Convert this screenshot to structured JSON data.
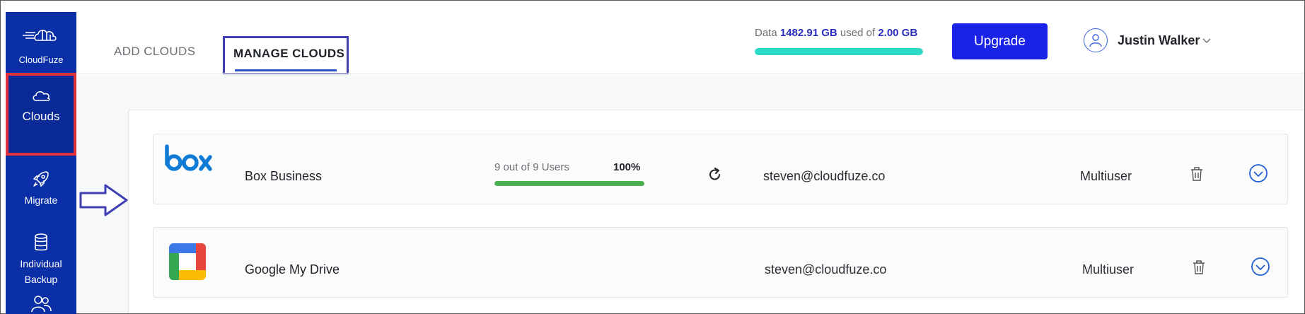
{
  "sidebar": {
    "brand": "CloudFuze",
    "items": [
      {
        "label": "Clouds",
        "icon": "cloud-icon"
      },
      {
        "label": "Migrate",
        "icon": "rocket-icon"
      },
      {
        "label": "Individual",
        "label2": "Backup",
        "icon": "database-icon"
      },
      {
        "label": "",
        "icon": "users-icon"
      }
    ]
  },
  "header": {
    "tabs": [
      {
        "label": "ADD CLOUDS"
      },
      {
        "label": "MANAGE CLOUDS",
        "active": true
      }
    ],
    "usage": {
      "prefix": "Data",
      "used": "1482.91 GB",
      "middle": "used of",
      "total": "2.00 GB",
      "fill_percent": 100
    },
    "upgrade_label": "Upgrade",
    "user_name": "Justin Walker"
  },
  "clouds": [
    {
      "name": "Box Business",
      "logo": "box-logo",
      "logo_text": "box",
      "users_text": "9 out of 9 Users",
      "percent": "100%",
      "progress": 100,
      "email": "steven@cloudfuze.co",
      "mode": "Multiuser"
    },
    {
      "name": "Google My Drive",
      "logo": "google-drive-logo",
      "email": "steven@cloudfuze.co",
      "mode": "Multiuser"
    }
  ],
  "colors": {
    "sidebar": "#0b2fa6",
    "upgrade": "#1a22e8",
    "usage_bar": "#2fd9c7",
    "user_progress": "#4caf50",
    "highlight_red": "#e0313c",
    "highlight_blue": "#3f3fb3"
  }
}
